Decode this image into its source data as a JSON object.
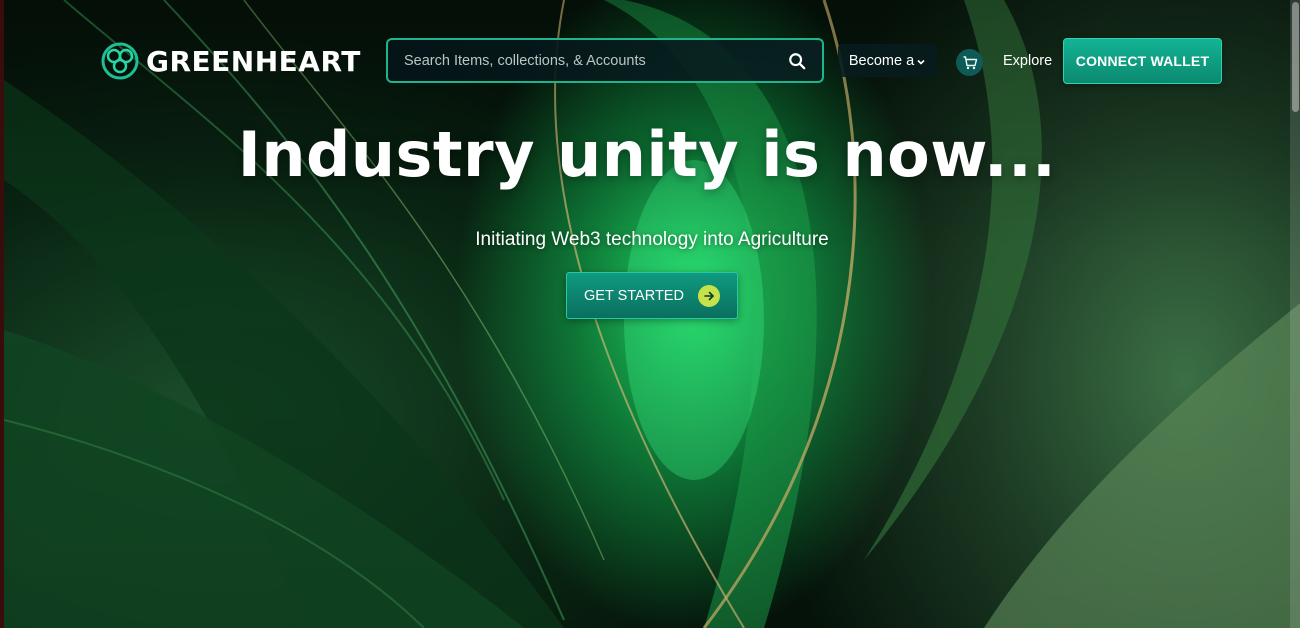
{
  "brand": {
    "name": "GREENHEART",
    "logo_icon": "celtic-knot-icon"
  },
  "header": {
    "search": {
      "placeholder": "Search Items, collections, & Accounts",
      "value": ""
    },
    "become_label": "Become a",
    "cart_icon": "cart-icon",
    "explore_label": "Explore",
    "connect_label": "CONNECT WALLET"
  },
  "hero": {
    "headline": "Industry unity is now...",
    "subheadline": "Initiating Web3 technology into Agriculture",
    "cta_label": "GET STARTED"
  },
  "colors": {
    "accent": "#13b394",
    "cta_arrow": "#c6e24a",
    "search_border": "#1fb58a"
  }
}
